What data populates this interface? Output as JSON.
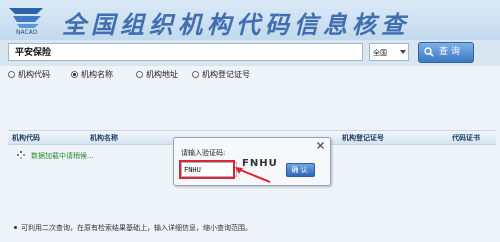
{
  "header": {
    "logo_text": "NACAO",
    "title": "全国组织机构代码信息核查"
  },
  "search": {
    "query": "平安保险",
    "scope": "全国",
    "button_label": "查询"
  },
  "search_types": [
    {
      "label": "机构代码",
      "selected": false
    },
    {
      "label": "机构名称",
      "selected": true
    },
    {
      "label": "机构地址",
      "selected": false
    },
    {
      "label": "机构登记证号",
      "selected": false
    }
  ],
  "table": {
    "columns": [
      "机构代码",
      "机构名称",
      "机构登记证号",
      "代码证书"
    ]
  },
  "loading_text": "数据加载中请稍候...",
  "captcha_dialog": {
    "prompt": "请输入验证码:",
    "captcha_text": "FNHU",
    "input_value": "FNHU",
    "confirm_label": "确认"
  },
  "footnote": "可利用二次查询，在原有检索结果基础上，输入详细信息，缩小查询范围。",
  "colors": {
    "title_blue": "#3f6fae",
    "loading_green": "#2b8a2b",
    "highlight_red": "#e0242b"
  }
}
